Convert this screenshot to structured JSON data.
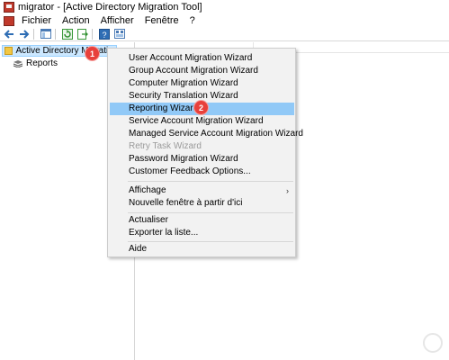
{
  "window": {
    "title": "migrator - [Active Directory Migration Tool]"
  },
  "menubar": {
    "items": [
      "Fichier",
      "Action",
      "Afficher",
      "Fenêtre",
      "?"
    ]
  },
  "toolbar": {
    "icons": [
      "back-arrow-icon",
      "forward-arrow-icon",
      "console-tree-icon",
      "refresh-icon",
      "export-icon",
      "help-icon",
      "view-icon"
    ]
  },
  "tree": {
    "root_label": "Active Directory Migration Tool",
    "child_label": "Reports"
  },
  "badges": {
    "first": "1",
    "second": "2"
  },
  "context_menu": {
    "items": [
      "User Account Migration Wizard",
      "Group Account Migration Wizard",
      "Computer Migration Wizard",
      "Security Translation Wizard",
      "Reporting Wizard",
      "Service Account Migration Wizard",
      "Managed Service Account Migration Wizard",
      "Retry Task Wizard",
      "Password Migration Wizard",
      "Customer Feedback Options...",
      "Affichage",
      "Nouvelle fenêtre à partir d'ici",
      "Actualiser",
      "Exporter la liste...",
      "Aide"
    ],
    "submenu_arrow": "›"
  },
  "colors": {
    "highlight": "#91c9f7",
    "badge": "#e8403b",
    "tree_selection": "#cce8ff"
  }
}
